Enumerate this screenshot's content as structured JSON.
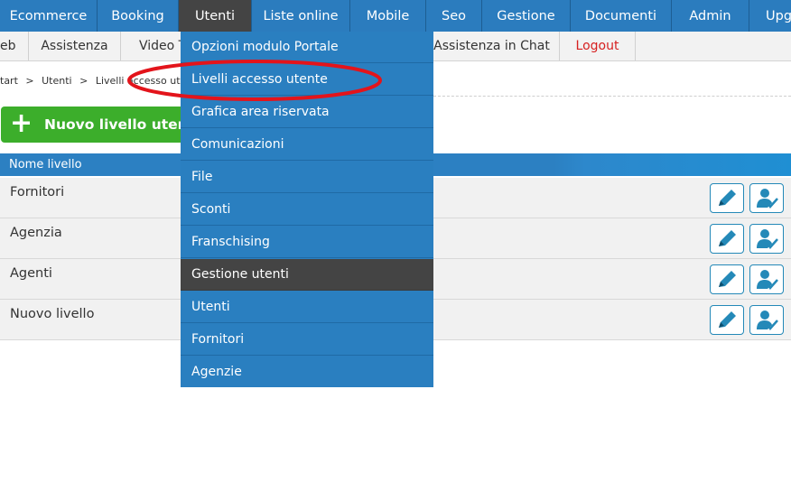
{
  "topnav": {
    "items": [
      "Ecommerce",
      "Booking",
      "Utenti",
      "Liste online",
      "Mobile",
      "Seo",
      "Gestione",
      "Documenti",
      "Admin",
      "Upg"
    ],
    "active": "Utenti"
  },
  "subnav": {
    "items": [
      "eb",
      "Assistenza",
      "Video T",
      "Assistenza in Chat",
      "Logout"
    ]
  },
  "breadcrumb": [
    "tart",
    "Utenti",
    "Livelli accesso utente"
  ],
  "breadcrumb_separator": ">",
  "new_level_button": {
    "icon": "plus-icon",
    "label": "Nuovo livello utente"
  },
  "table": {
    "header": "Nome livello",
    "rows": [
      "Fornitori",
      "Agenzia",
      "Agenti",
      "Nuovo livello"
    ],
    "row_actions": [
      "edit-pencil-icon",
      "user-check-icon"
    ]
  },
  "dropdown": {
    "items": [
      "Opzioni modulo Portale",
      "Livelli accesso utente",
      "Grafica area riservata",
      "Comunicazioni",
      "File",
      "Sconti",
      "Franschising",
      "Gestione utenti",
      "Utenti",
      "Fornitori",
      "Agenzie"
    ],
    "highlighted": "Gestione utenti",
    "circled": "Livelli accesso utente"
  },
  "colors": {
    "nav_blue": "#2b7cbe",
    "active_dark": "#444444",
    "button_green": "#3cae2b",
    "logout_red": "#d62020",
    "annotation_red": "#e3141b"
  }
}
